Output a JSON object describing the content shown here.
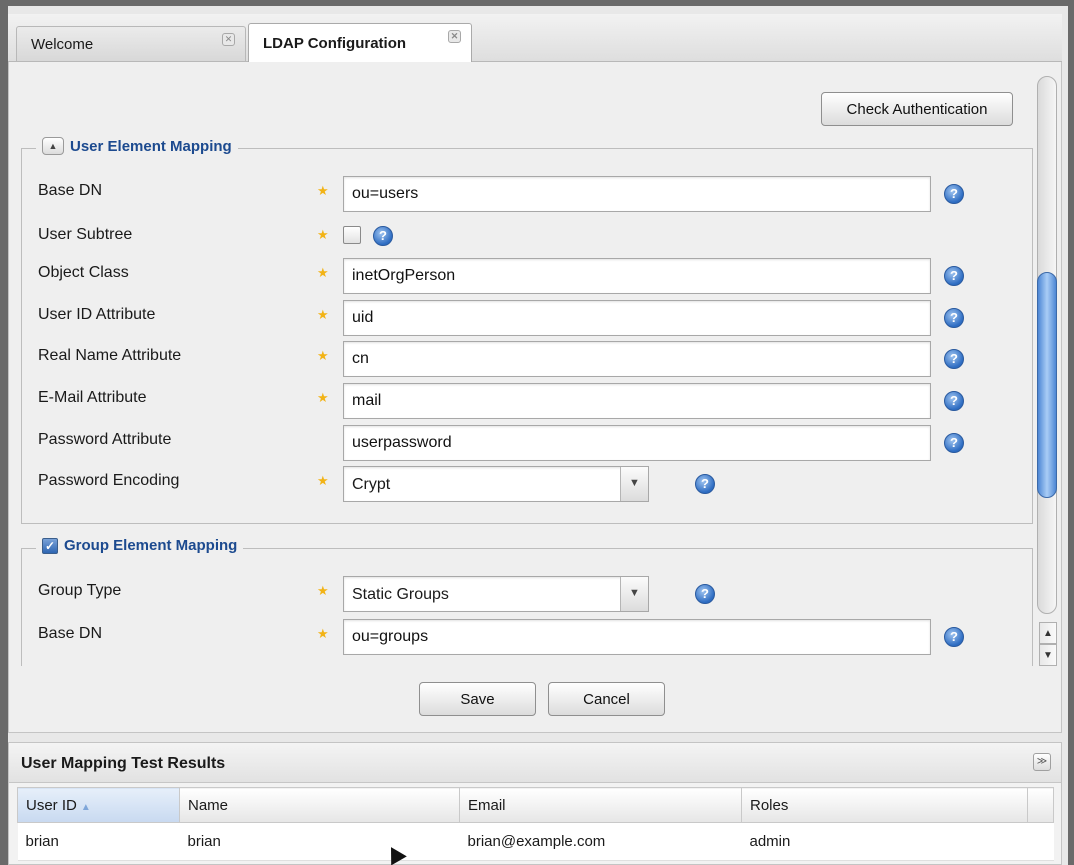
{
  "tabs": [
    {
      "label": "Welcome",
      "active": false
    },
    {
      "label": "LDAP Configuration",
      "active": true
    }
  ],
  "toolbar": {
    "check_auth_label": "Check Authentication"
  },
  "user_mapping": {
    "legend": "User Element Mapping",
    "fields": {
      "base_dn": {
        "label": "Base DN",
        "value": "ou=users"
      },
      "user_subtree": {
        "label": "User Subtree",
        "checked": false
      },
      "object_class": {
        "label": "Object Class",
        "value": "inetOrgPerson"
      },
      "user_id_attr": {
        "label": "User ID Attribute",
        "value": "uid"
      },
      "real_name_attr": {
        "label": "Real Name Attribute",
        "value": "cn"
      },
      "email_attr": {
        "label": "E-Mail Attribute",
        "value": "mail"
      },
      "password_attr": {
        "label": "Password Attribute",
        "value": "userpassword"
      },
      "password_encoding": {
        "label": "Password Encoding",
        "value": "Crypt"
      }
    }
  },
  "group_mapping": {
    "legend": "Group Element Mapping",
    "enabled": true,
    "fields": {
      "group_type": {
        "label": "Group Type",
        "value": "Static Groups"
      },
      "base_dn": {
        "label": "Base DN",
        "value": "ou=groups"
      }
    }
  },
  "actions": {
    "save_label": "Save",
    "cancel_label": "Cancel"
  },
  "results": {
    "title": "User Mapping Test Results",
    "columns": [
      "User ID",
      "Name",
      "Email",
      "Roles"
    ],
    "rows": [
      {
        "user_id": "brian",
        "name": "brian",
        "email": "brian@example.com",
        "roles": "admin"
      }
    ]
  },
  "colors": {
    "accent": "#1c4a8f",
    "required_star": "#f2b316",
    "help_icon": "#2d6cc2"
  },
  "icons": {
    "required": "star-icon",
    "help": "help-icon",
    "close": "close-icon",
    "collapse": "collapse-up-icon",
    "expand": "chevron-double-down-icon"
  }
}
